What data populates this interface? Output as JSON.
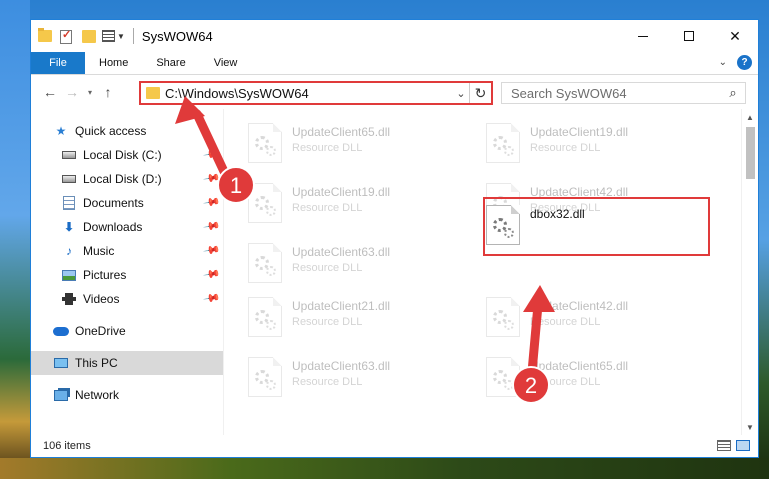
{
  "window": {
    "title": "SysWOW64",
    "controls": {
      "minimize": "",
      "maximize": "",
      "close": "✕"
    }
  },
  "ribbon": {
    "tabs": [
      "File",
      "Home",
      "Share",
      "View"
    ],
    "collapse_glyph": "⌄",
    "help_glyph": "?"
  },
  "nav": {
    "back_glyph": "←",
    "forward_glyph": "→",
    "recent_glyph": "▾",
    "up_glyph": "↑",
    "address": "C:\\Windows\\SysWOW64",
    "address_dropdown_glyph": "⌄",
    "refresh_glyph": "↻",
    "search_placeholder": "Search SysWOW64",
    "search_glyph": "⌕"
  },
  "sidebar": {
    "items": [
      {
        "label": "Quick access",
        "icon": "star-icon"
      },
      {
        "label": "Local Disk (C:)",
        "icon": "drive-icon",
        "pinned": true
      },
      {
        "label": "Local Disk (D:)",
        "icon": "drive-icon",
        "pinned": true
      },
      {
        "label": "Documents",
        "icon": "documents-icon",
        "pinned": true
      },
      {
        "label": "Downloads",
        "icon": "download-icon",
        "pinned": true
      },
      {
        "label": "Music",
        "icon": "music-icon",
        "pinned": true
      },
      {
        "label": "Pictures",
        "icon": "pictures-icon",
        "pinned": true
      },
      {
        "label": "Videos",
        "icon": "videos-icon",
        "pinned": true
      },
      {
        "label": "OneDrive",
        "icon": "onedrive-icon"
      },
      {
        "label": "This PC",
        "icon": "pc-icon",
        "selected": true
      },
      {
        "label": "Network",
        "icon": "network-icon"
      }
    ],
    "pin_glyph": "📌"
  },
  "files": {
    "items": [
      {
        "name": "UpdateClient65.dll",
        "type": "Resource DLL",
        "faded": true
      },
      {
        "name": "UpdateClient19.dll",
        "type": "Resource DLL",
        "faded": true
      },
      {
        "name": "UpdateClient19.dll",
        "type": "Resource DLL",
        "faded": true
      },
      {
        "name": "UpdateClient42.dll",
        "type": "Resource DLL",
        "faded": true
      },
      {
        "name": "UpdateClient63.dll",
        "type": "Resource DLL",
        "faded": true
      },
      {
        "name": "dbox32.dll",
        "type": "",
        "faded": false,
        "highlighted": true
      },
      {
        "name": "UpdateClient21.dll",
        "type": "Resource DLL",
        "faded": true
      },
      {
        "name": "UpdateClient42.dll",
        "type": "Resource DLL",
        "faded": true
      },
      {
        "name": "UpdateClient63.dll",
        "type": "Resource DLL",
        "faded": true
      },
      {
        "name": "UpdateClient65.dll",
        "type": "Resource DLL",
        "faded": true
      }
    ]
  },
  "status": {
    "count": "106 items"
  },
  "annotations": {
    "step1": "1",
    "step2": "2",
    "color": "#e03a3a"
  }
}
